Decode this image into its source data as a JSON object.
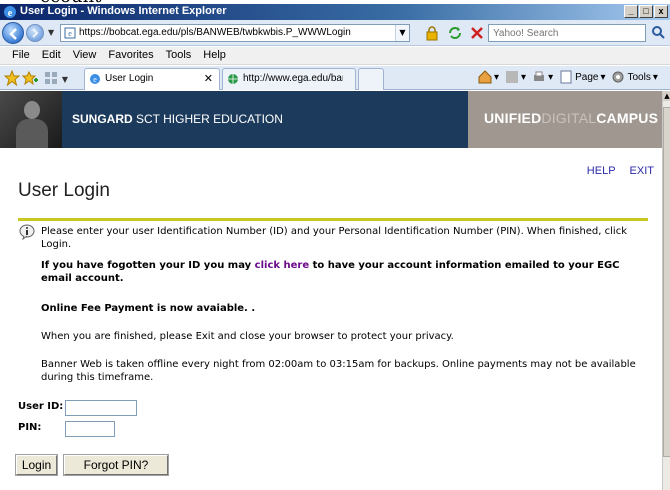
{
  "page_caption_fragment": "ccount",
  "window": {
    "title": "User Login - Windows Internet Explorer",
    "buttons": [
      "_",
      "□",
      "x"
    ]
  },
  "address_bar": {
    "url": "https://bobcat.ega.edu/pls/BANWEB/twbkwbis.P_WWWLogin",
    "search_placeholder": "Yahoo! Search"
  },
  "menu": {
    "items": [
      "File",
      "Edit",
      "View",
      "Favorites",
      "Tools",
      "Help"
    ]
  },
  "tabs": {
    "items": [
      {
        "label": "User Login",
        "active": true
      },
      {
        "label": "http://www.ega.edu/banner...",
        "active": false
      }
    ],
    "tools": {
      "page": "Page",
      "tools": "Tools"
    }
  },
  "banner": {
    "brand_bold": "SUNGARD",
    "brand_rest": " SCT HIGHER EDUCATION",
    "uc_part1": "UNIFIED",
    "uc_part2": "DIGITAL",
    "uc_part3": "CAMPUS"
  },
  "links": {
    "help": "HELP",
    "exit": "EXIT"
  },
  "page": {
    "title": "User Login",
    "msg1": "Please enter your user Identification Number (ID) and your Personal Identification Number (PIN). When finished, click Login.",
    "msg2_before": "If you have fogotten your ID you may ",
    "msg2_link": "click here",
    "msg2_after": " to have your account information emailed to your EGC email account.",
    "msg3": "Online Fee Payment is now avaiable. .",
    "msg4": "When you are finished, please Exit and close your browser to protect your privacy.",
    "msg5": "Banner Web is taken offline every night from 02:00am to 03:15am for backups. Online payments may not be available during this timeframe."
  },
  "form": {
    "user_id_label": "User ID:",
    "pin_label": "PIN:",
    "user_id_value": "",
    "pin_value": "",
    "login_button": "Login",
    "forgot_pin_button": "Forgot PIN?"
  },
  "colors": {
    "banner_blue": "#1c3a5c",
    "banner_grey": "#a09890",
    "rule_yellow": "#c8c820",
    "link_blue": "#2a2aaa",
    "link_purple": "#6a0a8a"
  }
}
